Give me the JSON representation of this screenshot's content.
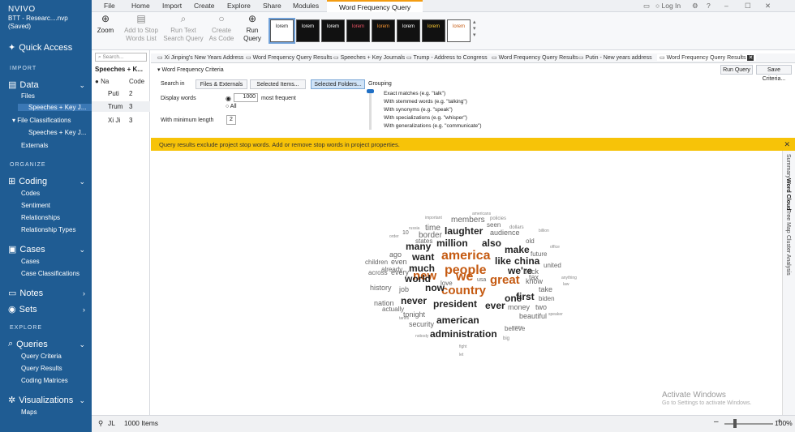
{
  "app": {
    "logo": "NVIVO",
    "project_line1": "BTT - Researc....nvp",
    "project_line2": "(Saved)"
  },
  "sidebar": {
    "quick_access": "Quick Access",
    "import_header": "IMPORT",
    "data": "Data",
    "files": "Files",
    "speeches_item": "Speeches + Key J...",
    "file_classifications": "File Classifications",
    "speeches_item2": "Speeches + Key J...",
    "externals": "Externals",
    "organize_header": "ORGANIZE",
    "coding": "Coding",
    "codes": "Codes",
    "sentiment": "Sentiment",
    "relationships": "Relationships",
    "relationship_types": "Relationship Types",
    "cases": "Cases",
    "cases_sub": "Cases",
    "case_classifications": "Case Classifications",
    "notes": "Notes",
    "sets": "Sets",
    "explore_header": "EXPLORE",
    "queries": "Queries",
    "query_criteria": "Query Criteria",
    "query_results": "Query Results",
    "coding_matrices": "Coding Matrices",
    "visualizations": "Visualizations",
    "maps": "Maps"
  },
  "menu": {
    "file": "File",
    "home": "Home",
    "import": "Import",
    "create": "Create",
    "explore": "Explore",
    "share": "Share",
    "modules": "Modules",
    "active": "Word Frequency Query",
    "login": "Log In"
  },
  "ribbon": {
    "zoom": "Zoom",
    "add_stop_1": "Add to Stop",
    "add_stop_2": "Words List",
    "run_text_1": "Run Text",
    "run_text_2": "Search Query",
    "create_code_1": "Create",
    "create_code_2": "As Code",
    "run_query_1": "Run",
    "run_query_2": "Query"
  },
  "thumbs": [
    "lorem",
    "lorem",
    "lorem",
    "lorem",
    "lorem",
    "lorem",
    "lorem",
    "lorem"
  ],
  "list": {
    "search_placeholder": "Search...",
    "header": "Speeches + K...",
    "col_name": "Na",
    "col_code": "Code",
    "rows": [
      {
        "name": "Puti",
        "code": "2"
      },
      {
        "name": "Trum",
        "code": "3"
      },
      {
        "name": "Xi Ji",
        "code": "3"
      }
    ]
  },
  "doc_tabs": [
    "Xi Jinping's New Years Address",
    "Word Frequency Query Results",
    "Speeches + Key Journals",
    "Trump - Address to Congress",
    "Word Frequency Query Results",
    "Putin - New years address",
    "Word Frequency Query Results"
  ],
  "criteria": {
    "title": "Word Frequency Criteria",
    "search_in": "Search in",
    "btn_files": "Files & Externals",
    "btn_selected_items": "Selected Items...",
    "btn_selected_folders": "Selected Folders...",
    "display_words": "Display words",
    "display_value": "1000",
    "most_frequent": "most frequent",
    "all": "All",
    "min_length": "With minimum length",
    "min_value": "2",
    "grouping": "Grouping",
    "group_options": [
      "Exact matches (e.g. \"talk\")",
      "With stemmed words (e.g. \"talking\")",
      "With synonyms (e.g. \"speak\")",
      "With specializations (e.g. \"whisper\")",
      "With generalizations (e.g. \"communicate\")"
    ],
    "run_query": "Run Query",
    "save_criteria": "Save Criteria..."
  },
  "banner": "Query results exclude project stop words. Add or remove stop words in project properties.",
  "vtabs": [
    "Summary",
    "Word Cloud",
    "Tree Map",
    "Cluster Analysis"
  ],
  "watermark": {
    "line1": "Activate Windows",
    "line2": "Go to Settings to activate Windows."
  },
  "status": {
    "user": "JL",
    "items": "1000 Items",
    "zoom": "100%"
  },
  "colors": {
    "sidebar": "#1f5c93",
    "accent": "#c55a11",
    "banner": "#f7c308"
  },
  "cloud_words": [
    {
      "t": "america",
      "s": 16,
      "c": "#c55a11"
    },
    {
      "t": "people",
      "s": 16,
      "c": "#c55a11"
    },
    {
      "t": "new",
      "s": 15,
      "c": "#c55a11"
    },
    {
      "t": "we",
      "s": 16,
      "c": "#c55a11"
    },
    {
      "t": "great",
      "s": 15,
      "c": "#c55a11"
    },
    {
      "t": "country",
      "s": 15,
      "c": "#c55a11"
    },
    {
      "t": "laughter",
      "s": 12,
      "c": "#222"
    },
    {
      "t": "million",
      "s": 12,
      "c": "#222"
    },
    {
      "t": "also",
      "s": 12,
      "c": "#222"
    },
    {
      "t": "make",
      "s": 12,
      "c": "#222"
    },
    {
      "t": "many",
      "s": 12,
      "c": "#222"
    },
    {
      "t": "want",
      "s": 12,
      "c": "#222"
    },
    {
      "t": "like",
      "s": 12,
      "c": "#222"
    },
    {
      "t": "china",
      "s": 12,
      "c": "#222"
    },
    {
      "t": "much",
      "s": 12,
      "c": "#222"
    },
    {
      "t": "we're",
      "s": 12,
      "c": "#222"
    },
    {
      "t": "world",
      "s": 12,
      "c": "#222"
    },
    {
      "t": "now",
      "s": 12,
      "c": "#222"
    },
    {
      "t": "first",
      "s": 12,
      "c": "#222"
    },
    {
      "t": "one",
      "s": 12,
      "c": "#222"
    },
    {
      "t": "never",
      "s": 12,
      "c": "#222"
    },
    {
      "t": "president",
      "s": 12,
      "c": "#222"
    },
    {
      "t": "ever",
      "s": 12,
      "c": "#222"
    },
    {
      "t": "american",
      "s": 12,
      "c": "#222"
    },
    {
      "t": "administration",
      "s": 12,
      "c": "#222"
    },
    {
      "t": "time",
      "s": 10,
      "c": "#666"
    },
    {
      "t": "members",
      "s": 10,
      "c": "#666"
    },
    {
      "t": "border",
      "s": 10,
      "c": "#666"
    },
    {
      "t": "audience",
      "s": 9,
      "c": "#666"
    },
    {
      "t": "old",
      "s": 8,
      "c": "#666"
    },
    {
      "t": "future",
      "s": 8,
      "c": "#666"
    },
    {
      "t": "united",
      "s": 8,
      "c": "#666"
    },
    {
      "t": "back",
      "s": 9,
      "c": "#666"
    },
    {
      "t": "tax",
      "s": 9,
      "c": "#666"
    },
    {
      "t": "know",
      "s": 9,
      "c": "#666"
    },
    {
      "t": "take",
      "s": 9,
      "c": "#666"
    },
    {
      "t": "biden",
      "s": 8,
      "c": "#666"
    },
    {
      "t": "ago",
      "s": 9,
      "c": "#666"
    },
    {
      "t": "even",
      "s": 9,
      "c": "#666"
    },
    {
      "t": "every",
      "s": 9,
      "c": "#666"
    },
    {
      "t": "children",
      "s": 8,
      "c": "#666"
    },
    {
      "t": "across",
      "s": 8,
      "c": "#666"
    },
    {
      "t": "already",
      "s": 8,
      "c": "#666"
    },
    {
      "t": "history",
      "s": 9,
      "c": "#666"
    },
    {
      "t": "job",
      "s": 9,
      "c": "#666"
    },
    {
      "t": "nation",
      "s": 9,
      "c": "#666"
    },
    {
      "t": "actually",
      "s": 8,
      "c": "#666"
    },
    {
      "t": "tonight",
      "s": 9,
      "c": "#666"
    },
    {
      "t": "security",
      "s": 9,
      "c": "#666"
    },
    {
      "t": "money",
      "s": 9,
      "c": "#666"
    },
    {
      "t": "two",
      "s": 9,
      "c": "#666"
    },
    {
      "t": "beautiful",
      "s": 9,
      "c": "#666"
    },
    {
      "t": "believe",
      "s": 8,
      "c": "#666"
    },
    {
      "t": "states",
      "s": 8,
      "c": "#666"
    },
    {
      "t": "seen",
      "s": 8,
      "c": "#666"
    },
    {
      "t": "love",
      "s": 8,
      "c": "#666"
    },
    {
      "t": "usa",
      "s": 7,
      "c": "#666"
    },
    {
      "t": "10",
      "s": 7,
      "c": "#666"
    },
    {
      "t": "dollars",
      "s": 6,
      "c": "#888"
    },
    {
      "t": "big",
      "s": 6,
      "c": "#888"
    },
    {
      "t": "policies",
      "s": 6,
      "c": "#888"
    },
    {
      "t": "americans",
      "s": 5,
      "c": "#888"
    },
    {
      "t": "important",
      "s": 5,
      "c": "#888"
    },
    {
      "t": "russia",
      "s": 5,
      "c": "#888"
    },
    {
      "t": "billion",
      "s": 5,
      "c": "#888"
    },
    {
      "t": "office",
      "s": 5,
      "c": "#888"
    },
    {
      "t": "anything",
      "s": 5,
      "c": "#888"
    },
    {
      "t": "law",
      "s": 5,
      "c": "#888"
    },
    {
      "t": "speaker",
      "s": 5,
      "c": "#888"
    },
    {
      "t": "tariffs",
      "s": 5,
      "c": "#888"
    },
    {
      "t": "fight",
      "s": 5,
      "c": "#888"
    },
    {
      "t": "nobody",
      "s": 5,
      "c": "#888"
    },
    {
      "t": "order",
      "s": 5,
      "c": "#888"
    },
    {
      "t": "come",
      "s": 5,
      "c": "#888"
    },
    {
      "t": "let",
      "s": 5,
      "c": "#888"
    }
  ]
}
